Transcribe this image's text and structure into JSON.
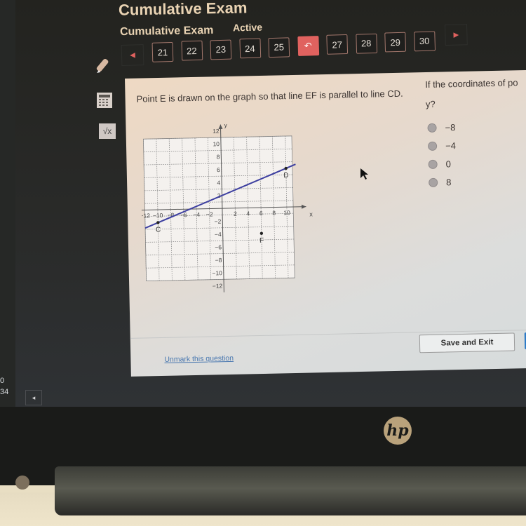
{
  "app": {
    "title": "Cumulative Exam",
    "subtitle": "Cumulative Exam",
    "status": "Active"
  },
  "nav": {
    "prev_icon": "triangle-left-icon",
    "next_icon": "triangle-right-icon",
    "questions": [
      {
        "label": "21",
        "current": false
      },
      {
        "label": "22",
        "current": false
      },
      {
        "label": "23",
        "current": false
      },
      {
        "label": "24",
        "current": false
      },
      {
        "label": "25",
        "current": false
      },
      {
        "label": "",
        "current": true,
        "icon": "return-arrow-icon"
      },
      {
        "label": "27",
        "current": false
      },
      {
        "label": "28",
        "current": false
      },
      {
        "label": "29",
        "current": false
      },
      {
        "label": "30",
        "current": false
      }
    ],
    "current_icon_glyph": "↶"
  },
  "tools": {
    "items": [
      "pencil-icon",
      "calculator-icon",
      "formula-icon"
    ],
    "formula_glyph": "√x"
  },
  "question": {
    "text": "Point E is drawn on the graph so that line EF is parallel to line CD.",
    "prompt_partial": "If the coordinates of po",
    "prompt_line2": "y?",
    "options": [
      "−8",
      "−4",
      "0",
      "8"
    ]
  },
  "graph": {
    "x_range": [
      -12,
      12
    ],
    "y_range": [
      -12,
      12
    ],
    "x_ticks": [
      "−12",
      "−10",
      "−8",
      "−6",
      "−4",
      "−2",
      "2",
      "4",
      "6",
      "8",
      "10"
    ],
    "y_ticks": [
      "12",
      "10",
      "8",
      "6",
      "4",
      "2",
      "−2",
      "−4",
      "−6",
      "−8",
      "−10",
      "−12"
    ],
    "x_label": "x",
    "y_label": "y",
    "points": [
      {
        "name": "C",
        "x": -10,
        "y": -2
      },
      {
        "name": "D",
        "x": 10,
        "y": 6
      },
      {
        "name": "F",
        "x": 6,
        "y": -4
      }
    ],
    "line_color": "#3d3fa0"
  },
  "footer": {
    "unmark_label": "Unmark this question",
    "save_exit_label": "Save and Exit"
  },
  "taskbar": {
    "left_numbers": [
      "0",
      "34"
    ],
    "button_glyph": "◂"
  },
  "brand": {
    "logo_text": "hp"
  }
}
